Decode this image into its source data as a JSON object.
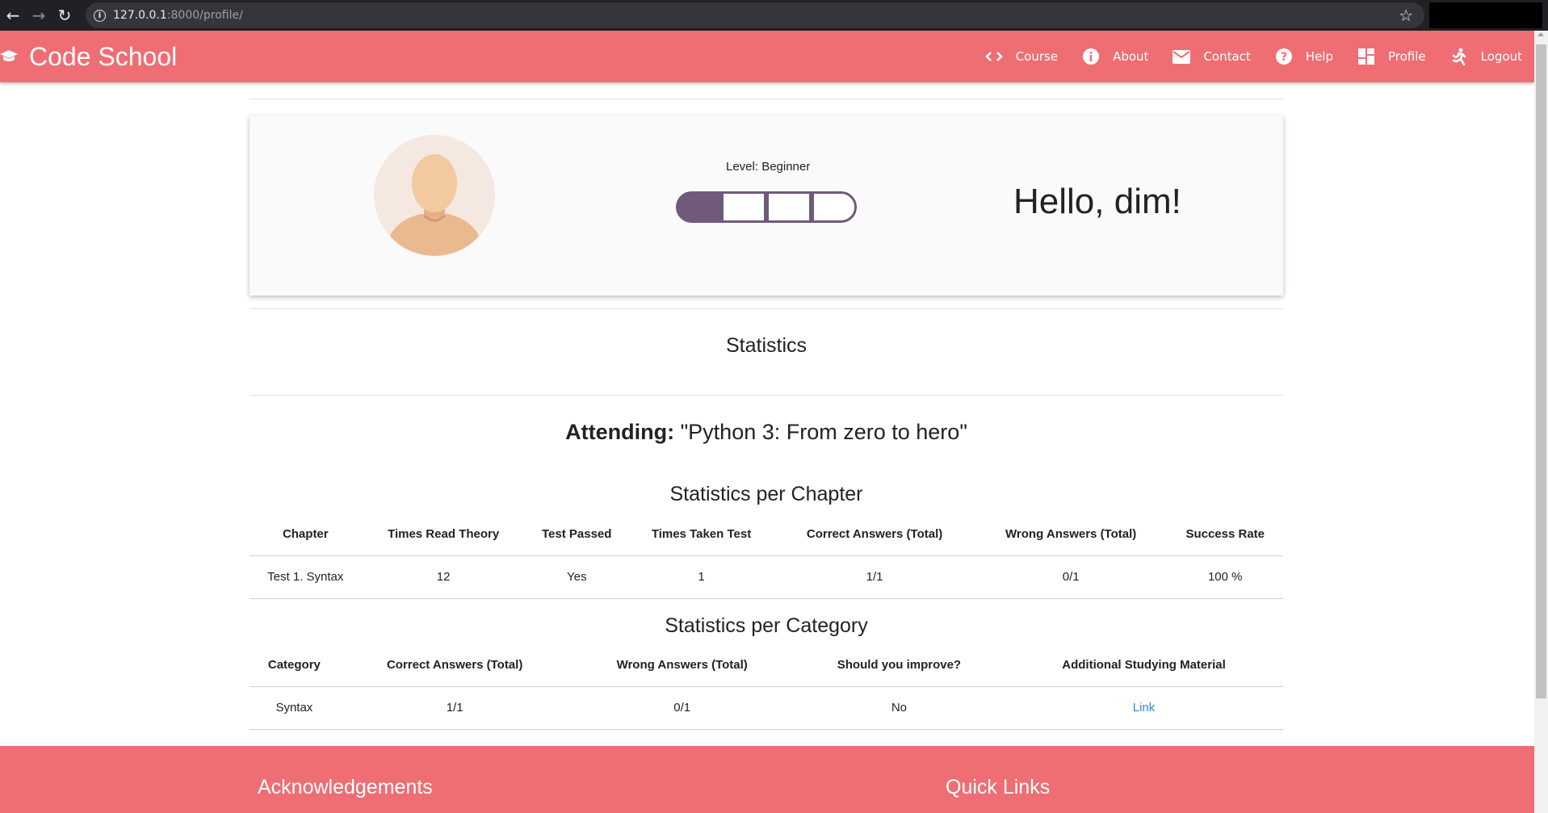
{
  "browser": {
    "url_host": "127.0.0.1",
    "url_path": ":8000/profile/"
  },
  "navbar": {
    "brand": "Code School",
    "links": [
      {
        "label": "Course",
        "icon": "code-icon"
      },
      {
        "label": "About",
        "icon": "info-icon"
      },
      {
        "label": "Contact",
        "icon": "mail-icon"
      },
      {
        "label": "Help",
        "icon": "help-icon"
      },
      {
        "label": "Profile",
        "icon": "dashboard-icon"
      },
      {
        "label": "Logout",
        "icon": "run-icon"
      }
    ]
  },
  "profile": {
    "level_label": "Level: Beginner",
    "level_filled": 1,
    "level_total": 4,
    "greeting": "Hello, dim!"
  },
  "statistics": {
    "title": "Statistics",
    "attending_label": "Attending:",
    "attending_course": "\"Python 3: From zero to hero\""
  },
  "chapter_table": {
    "title": "Statistics per Chapter",
    "headers": [
      "Chapter",
      "Times Read Theory",
      "Test Passed",
      "Times Taken Test",
      "Correct Answers (Total)",
      "Wrong Answers (Total)",
      "Success Rate"
    ],
    "rows": [
      [
        "Test 1. Syntax",
        "12",
        "Yes",
        "1",
        "1/1",
        "0/1",
        "100 %"
      ]
    ]
  },
  "category_table": {
    "title": "Statistics per Category",
    "headers": [
      "Category",
      "Correct Answers (Total)",
      "Wrong Answers (Total)",
      "Should you improve?",
      "Additional Studying Material"
    ],
    "rows": [
      [
        "Syntax",
        "1/1",
        "0/1",
        "No",
        "Link"
      ]
    ]
  },
  "footer": {
    "acknowledgements": "Acknowledgements",
    "quick_links": "Quick Links"
  },
  "colors": {
    "primary": "#ee6e73",
    "level_bar": "#6f5a7b",
    "link": "#3a86c4"
  }
}
